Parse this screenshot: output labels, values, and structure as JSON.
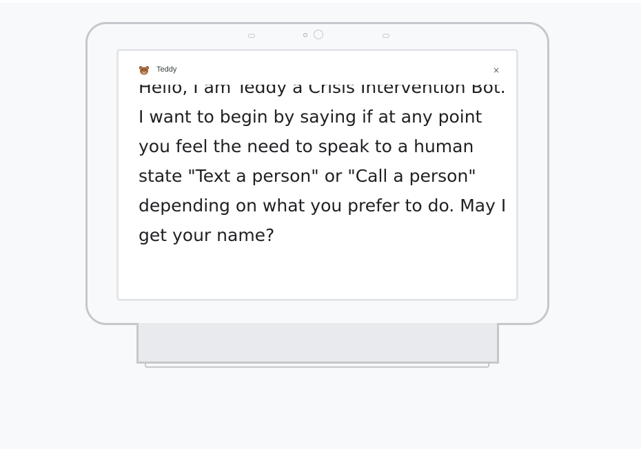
{
  "app": {
    "name": "Teddy",
    "icon": "teddy-bear-icon",
    "close_glyph": "×"
  },
  "message": {
    "text": "Hello, I am Teddy a Crisis Intervention Bot. I want to begin by saying if at any point you feel the need to speak to a human state \"Text a person\" or \"Call a person\" depending on what you prefer to do. May I get your name?"
  },
  "colors": {
    "frame": "#c4c7cb",
    "screen_border": "#e3e5e8",
    "background": "#f8f9fa",
    "text": "#202124"
  }
}
